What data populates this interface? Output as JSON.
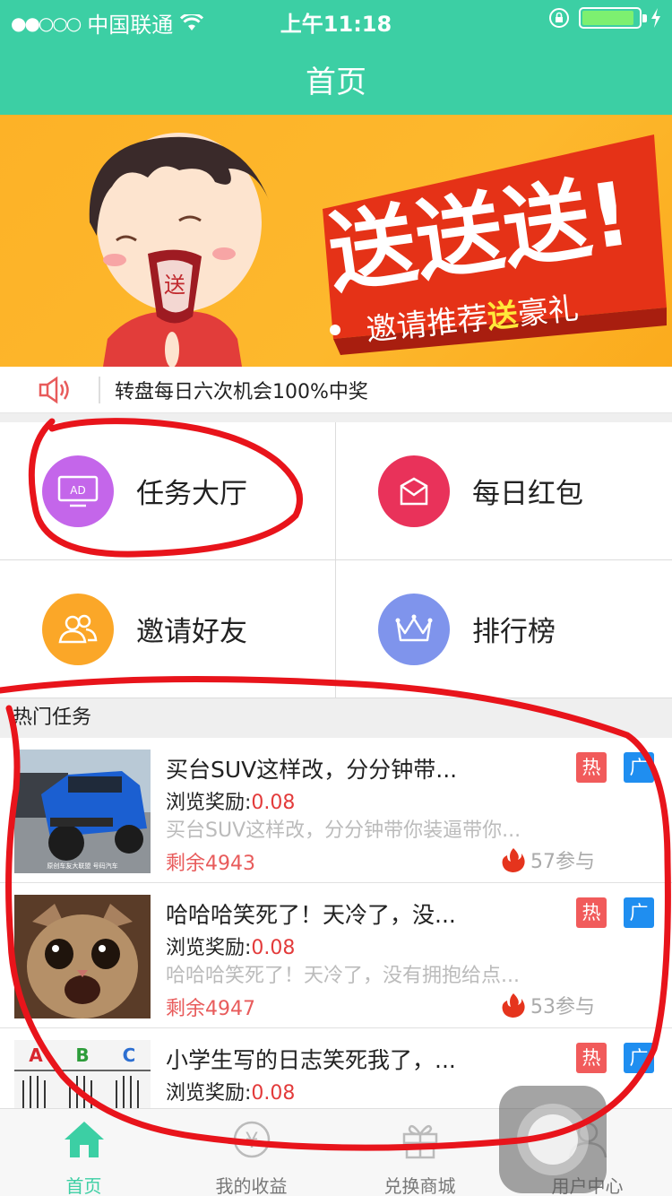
{
  "status_bar": {
    "signal_dots": "●●○○○",
    "carrier": "中国联通",
    "time": "上午11:18",
    "battery_level": 0.92
  },
  "header": {
    "title": "首页"
  },
  "banner": {
    "headline": "送送送!",
    "subline_before": "邀请推荐",
    "subline_highlight": "送",
    "subline_after": "豪礼",
    "mascot_shirt_text": "送"
  },
  "notice": {
    "text": "转盘每日六次机会100%中奖"
  },
  "grid": [
    {
      "label": "任务大厅",
      "icon": "ad-screen-icon",
      "color": "#c466ea",
      "icon_text": "AD"
    },
    {
      "label": "每日红包",
      "icon": "red-packet-icon",
      "color": "#e9325a"
    },
    {
      "label": "邀请好友",
      "icon": "friends-icon",
      "color": "#fba728"
    },
    {
      "label": "排行榜",
      "icon": "crown-icon",
      "color": "#7f94ec"
    }
  ],
  "section": {
    "title": "热门任务"
  },
  "tasks": [
    {
      "title": "买台SUV这样改，分分钟带...",
      "reward_label": "浏览奖励:",
      "reward_value": "0.08",
      "desc": "买台SUV这样改，分分钟带你装逼带你...",
      "remain": "剩余4943",
      "participants": "57参与",
      "hot_badge": "热",
      "ad_badge": "广",
      "thumb_caption": "原创车友大联盟 号码汽车"
    },
    {
      "title": "哈哈哈笑死了！天冷了，没...",
      "reward_label": "浏览奖励:",
      "reward_value": "0.08",
      "desc": "哈哈哈笑死了！天冷了，没有拥抱给点...",
      "remain": "剩余4947",
      "participants": "53参与",
      "hot_badge": "热",
      "ad_badge": "广"
    },
    {
      "title": "小学生写的日志笑死我了，...",
      "reward_label": "浏览奖励:",
      "reward_value": "0.08",
      "hot_badge": "热",
      "ad_badge": "广",
      "thumb_letters": [
        "A",
        "B",
        "C"
      ]
    }
  ],
  "tabs": [
    {
      "label": "首页",
      "icon": "home-icon"
    },
    {
      "label": "我的收益",
      "icon": "yen-coin-icon",
      "glyph": "¥"
    },
    {
      "label": "兑换商城",
      "icon": "gift-icon"
    },
    {
      "label": "用户中心",
      "icon": "user-icon"
    }
  ],
  "colors": {
    "brand": "#3ccfa4",
    "banner": "#fdb227",
    "price_red": "#e33b3b",
    "hot_badge": "#f15b5b",
    "ad_badge": "#1f8ef0",
    "annotation_red": "#e8141b"
  }
}
